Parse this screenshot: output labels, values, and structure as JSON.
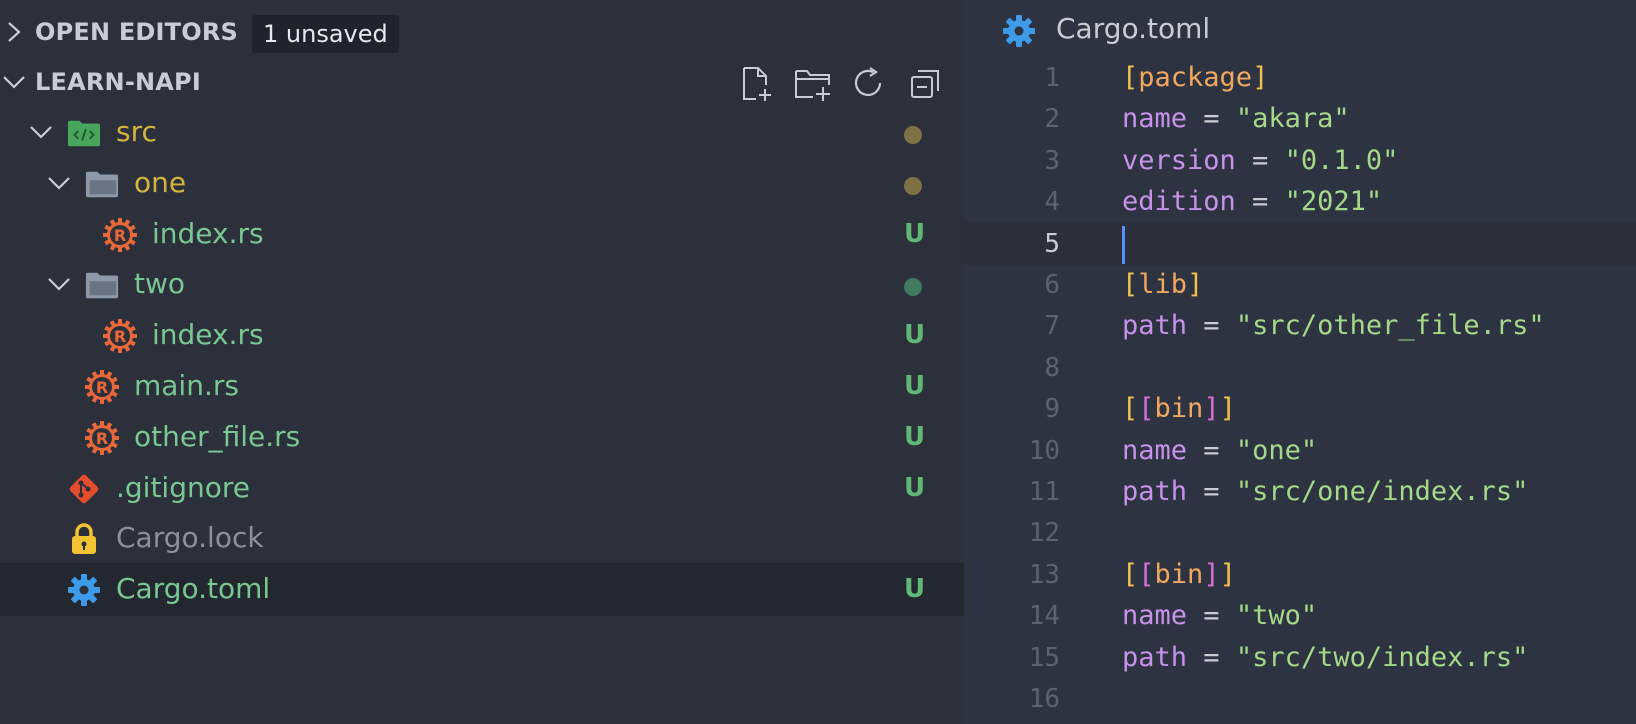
{
  "explorer": {
    "open_editors": {
      "title": "OPEN EDITORS",
      "badge": "1 unsaved"
    },
    "workspace": {
      "title": "LEARN-NAPI"
    },
    "toolbar": [
      {
        "name": "new-file-button",
        "icon": "new-file-icon"
      },
      {
        "name": "new-folder-button",
        "icon": "new-folder-icon"
      },
      {
        "name": "refresh-button",
        "icon": "refresh-icon"
      },
      {
        "name": "collapse-all-button",
        "icon": "collapse-all-icon"
      }
    ],
    "tree": [
      {
        "label": "src",
        "type": "folder-src",
        "depth": 1,
        "expanded": true,
        "decor": "dot",
        "dot_color": "#7d7145",
        "text_color": "yellow"
      },
      {
        "label": "one",
        "type": "folder",
        "depth": 2,
        "expanded": true,
        "decor": "dot",
        "dot_color": "#7d7145",
        "text_color": "yellow"
      },
      {
        "label": "index.rs",
        "type": "rust",
        "depth": 3,
        "decor": "status",
        "status": "U",
        "text_color": "green"
      },
      {
        "label": "two",
        "type": "folder",
        "depth": 2,
        "expanded": true,
        "decor": "dot",
        "dot_color": "#3f7a5e",
        "text_color": "green"
      },
      {
        "label": "index.rs",
        "type": "rust",
        "depth": 3,
        "decor": "status",
        "status": "U",
        "text_color": "green"
      },
      {
        "label": "main.rs",
        "type": "rust",
        "depth": 2,
        "decor": "status",
        "status": "U",
        "text_color": "green"
      },
      {
        "label": "other_file.rs",
        "type": "rust",
        "depth": 2,
        "decor": "status",
        "status": "U",
        "text_color": "green"
      },
      {
        "label": ".gitignore",
        "type": "git",
        "depth": 1,
        "decor": "status",
        "status": "U",
        "text_color": "green"
      },
      {
        "label": "Cargo.lock",
        "type": "lock",
        "depth": 1,
        "decor": "none",
        "text_color": "grey"
      },
      {
        "label": "Cargo.toml",
        "type": "gear",
        "depth": 1,
        "decor": "status",
        "status": "U",
        "text_color": "green",
        "selected": true
      }
    ]
  },
  "editor": {
    "tab": {
      "label": "Cargo.toml",
      "icon": "gear-icon"
    },
    "active_line": 5,
    "lines": [
      {
        "n": "1",
        "tokens": [
          [
            "br",
            "["
          ],
          [
            "sec",
            "package"
          ],
          [
            "br",
            "]"
          ]
        ]
      },
      {
        "n": "2",
        "tokens": [
          [
            "key",
            "name"
          ],
          [
            "op",
            " = "
          ],
          [
            "str",
            "\"akara\""
          ]
        ]
      },
      {
        "n": "3",
        "tokens": [
          [
            "key",
            "version"
          ],
          [
            "op",
            " = "
          ],
          [
            "str",
            "\"0.1.0\""
          ]
        ]
      },
      {
        "n": "4",
        "tokens": [
          [
            "key",
            "edition"
          ],
          [
            "op",
            " = "
          ],
          [
            "str",
            "\"2021\""
          ]
        ]
      },
      {
        "n": "5",
        "tokens": []
      },
      {
        "n": "6",
        "tokens": [
          [
            "br",
            "["
          ],
          [
            "sec",
            "lib"
          ],
          [
            "br",
            "]"
          ]
        ]
      },
      {
        "n": "7",
        "tokens": [
          [
            "key",
            "path"
          ],
          [
            "op",
            " = "
          ],
          [
            "str",
            "\"src/other_file.rs\""
          ]
        ]
      },
      {
        "n": "8",
        "tokens": []
      },
      {
        "n": "9",
        "tokens": [
          [
            "br",
            "["
          ],
          [
            "br2",
            "["
          ],
          [
            "sec",
            "bin"
          ],
          [
            "br2",
            "]"
          ],
          [
            "br",
            "]"
          ]
        ]
      },
      {
        "n": "10",
        "tokens": [
          [
            "key",
            "name"
          ],
          [
            "op",
            " = "
          ],
          [
            "str",
            "\"one\""
          ]
        ]
      },
      {
        "n": "11",
        "tokens": [
          [
            "key",
            "path"
          ],
          [
            "op",
            " = "
          ],
          [
            "str",
            "\"src/one/index.rs\""
          ]
        ]
      },
      {
        "n": "12",
        "tokens": []
      },
      {
        "n": "13",
        "tokens": [
          [
            "br",
            "["
          ],
          [
            "br2",
            "["
          ],
          [
            "sec",
            "bin"
          ],
          [
            "br2",
            "]"
          ],
          [
            "br",
            "]"
          ]
        ]
      },
      {
        "n": "14",
        "tokens": [
          [
            "key",
            "name"
          ],
          [
            "op",
            " = "
          ],
          [
            "str",
            "\"two\""
          ]
        ]
      },
      {
        "n": "15",
        "tokens": [
          [
            "key",
            "path"
          ],
          [
            "op",
            " = "
          ],
          [
            "str",
            "\"src/two/index.rs\""
          ]
        ]
      },
      {
        "n": "16",
        "tokens": []
      }
    ]
  }
}
